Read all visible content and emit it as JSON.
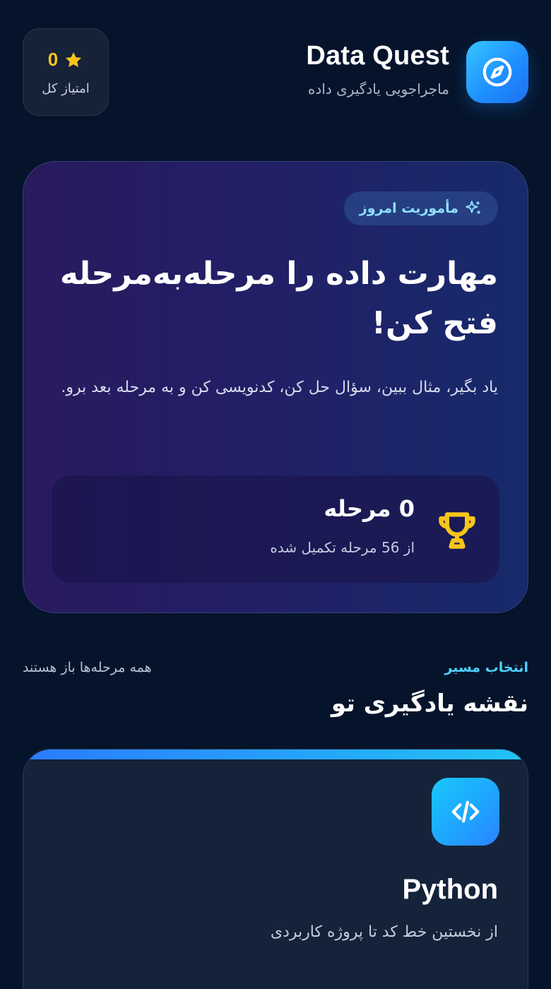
{
  "header": {
    "app_title": "Data Quest",
    "app_subtitle": "ماجراجویی یادگیری داده",
    "logo_icon": "compass-icon"
  },
  "score": {
    "value": "0",
    "label": "امتیاز کل",
    "icon": "star-icon",
    "color": "#f9c41a"
  },
  "hero": {
    "badge": "مأموریت امروز",
    "badge_icon": "sparkles-icon",
    "title": "مهارت داده را مرحله‌به‌مرحله فتح کن!",
    "description": "یاد بگیر، مثال ببین، سؤال حل کن، کدنویسی کن و به مرحله بعد برو.",
    "progress_main": "0 مرحله",
    "progress_sub": "از 56 مرحله تکمیل شده",
    "progress_icon": "trophy-icon"
  },
  "roadmap": {
    "kicker": "انتخاب مسیر",
    "title": "نقشه یادگیری تو",
    "note": "همه مرحله‌ها باز هستند"
  },
  "paths": [
    {
      "name": "Python",
      "description": "از نخستین خط کد تا پروژه کاربردی",
      "icon": "code-icon"
    }
  ],
  "colors": {
    "accent_cyan": "#4fd1ff",
    "background": "#06142b",
    "gold": "#f9c41a"
  }
}
